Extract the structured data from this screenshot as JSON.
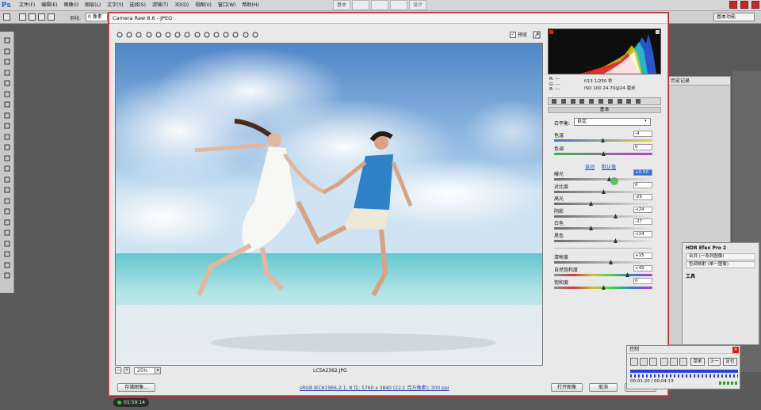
{
  "ps": {
    "menus": [
      "文件(F)",
      "编辑(E)",
      "图像(I)",
      "图层(L)",
      "文字(Y)",
      "选择(S)",
      "滤镜(T)",
      "3D(D)",
      "视图(V)",
      "窗口(W)",
      "帮助(H)"
    ],
    "center_buttons": [
      "基本",
      "",
      "",
      "",
      "设计"
    ],
    "options": {
      "feather_label": "羽化:",
      "feather_value": "0 像素"
    },
    "workspace": "基本功能",
    "history_tab": "历史记录"
  },
  "camera_raw": {
    "title": "Camera Raw 8.6 - JPEG",
    "preview_label": "预览",
    "preview_checked": true,
    "histogram": {
      "rgb_lines": [
        "R: ---",
        "G: ---",
        "B: ---"
      ],
      "camera_info": [
        "f/13  1/250 秒",
        "ISO 100  24-70@24 毫米"
      ]
    },
    "section": "基本",
    "white_balance": {
      "label": "白平衡:",
      "value": "自定"
    },
    "sliders_wb": [
      {
        "label": "色温",
        "value": "-4",
        "pos": 0.49
      },
      {
        "label": "色调",
        "value": "0",
        "pos": 0.5
      }
    ],
    "auto_label": "自动",
    "default_label": "默认值",
    "sliders_tone": [
      {
        "label": "曝光",
        "value": "+0.50",
        "pos": 0.56,
        "selected": true
      },
      {
        "label": "对比度",
        "value": "0",
        "pos": 0.5
      },
      {
        "label": "高光",
        "value": "-25",
        "pos": 0.37
      },
      {
        "label": "阴影",
        "value": "+24",
        "pos": 0.62
      },
      {
        "label": "白色",
        "value": "-27",
        "pos": 0.37
      },
      {
        "label": "黑色",
        "value": "+24",
        "pos": 0.62
      }
    ],
    "sliders_presence": [
      {
        "label": "清晰度",
        "value": "+15",
        "pos": 0.57
      },
      {
        "label": "自然饱和度",
        "value": "+49",
        "pos": 0.74
      },
      {
        "label": "饱和度",
        "value": "0",
        "pos": 0.5
      }
    ],
    "zoom": "25%",
    "filename": "LC5A2362.JPG",
    "save_button": "存储图像...",
    "workflow": "sRGB IEC61966-2.1; 8 位; 5760 x 3840 (22.1 百万像素); 300 ppi",
    "open_button": "打开图像",
    "cancel_button": "取消",
    "done_button": "完成"
  },
  "nik": {
    "title": "HDR Efex Pro 2",
    "items": [
      "合并 (一系列图像)",
      "色调映射 (单一图像)"
    ],
    "tools": "工具"
  },
  "control": {
    "title": "控制",
    "buttons": [
      "菜单",
      "上一",
      "定位"
    ],
    "time": "00:01:20 / 00:04:13"
  },
  "timer": "01:59:14",
  "colors": {
    "accent": "#3a6fd8",
    "ps_blue": "#1d6fd1",
    "sky": "#5d94cf",
    "sea": "#7fd0d8"
  }
}
